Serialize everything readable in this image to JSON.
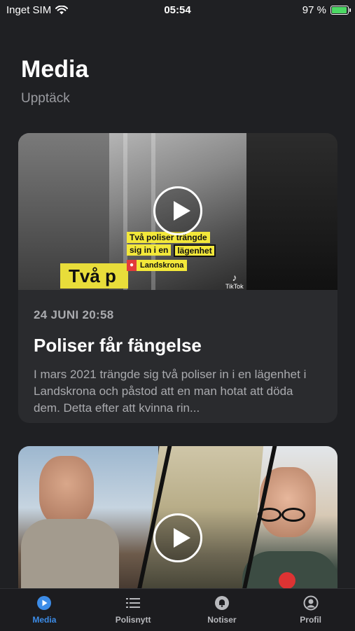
{
  "status_bar": {
    "carrier": "Inget SIM",
    "time": "05:54",
    "battery": "97 %",
    "battery_level": 0.97
  },
  "header": {
    "title": "Media",
    "subtitle": "Upptäck"
  },
  "cards": [
    {
      "date": "24 JUNI 20:58",
      "headline": "Poliser får fängelse",
      "excerpt": "I mars 2021 trängde sig två poliser in i en lägenhet i Landskrona och påstod att en man hotat att döda dem. Detta efter att kvinna rin...",
      "thumbnail": {
        "band_text": "Två p",
        "caption_line1": "Två poliser trängde",
        "caption_line2a": "sig in i en",
        "caption_line2b": "lägenhet",
        "location": "Landskrona",
        "watermark": "TikTok"
      }
    },
    {
      "thumbnail": {}
    }
  ],
  "tab_bar": {
    "items": [
      {
        "label": "Media",
        "icon": "play-circle-icon",
        "active": true
      },
      {
        "label": "Polisnytt",
        "icon": "list-icon",
        "active": false
      },
      {
        "label": "Notiser",
        "icon": "bell-icon",
        "active": false
      },
      {
        "label": "Profil",
        "icon": "user-icon",
        "active": false
      }
    ]
  },
  "colors": {
    "background": "#1f2023",
    "card": "#2a2b2e",
    "accent": "#3c8ce7",
    "battery_green": "#4cd964",
    "caption_yellow": "#f3e83a"
  }
}
